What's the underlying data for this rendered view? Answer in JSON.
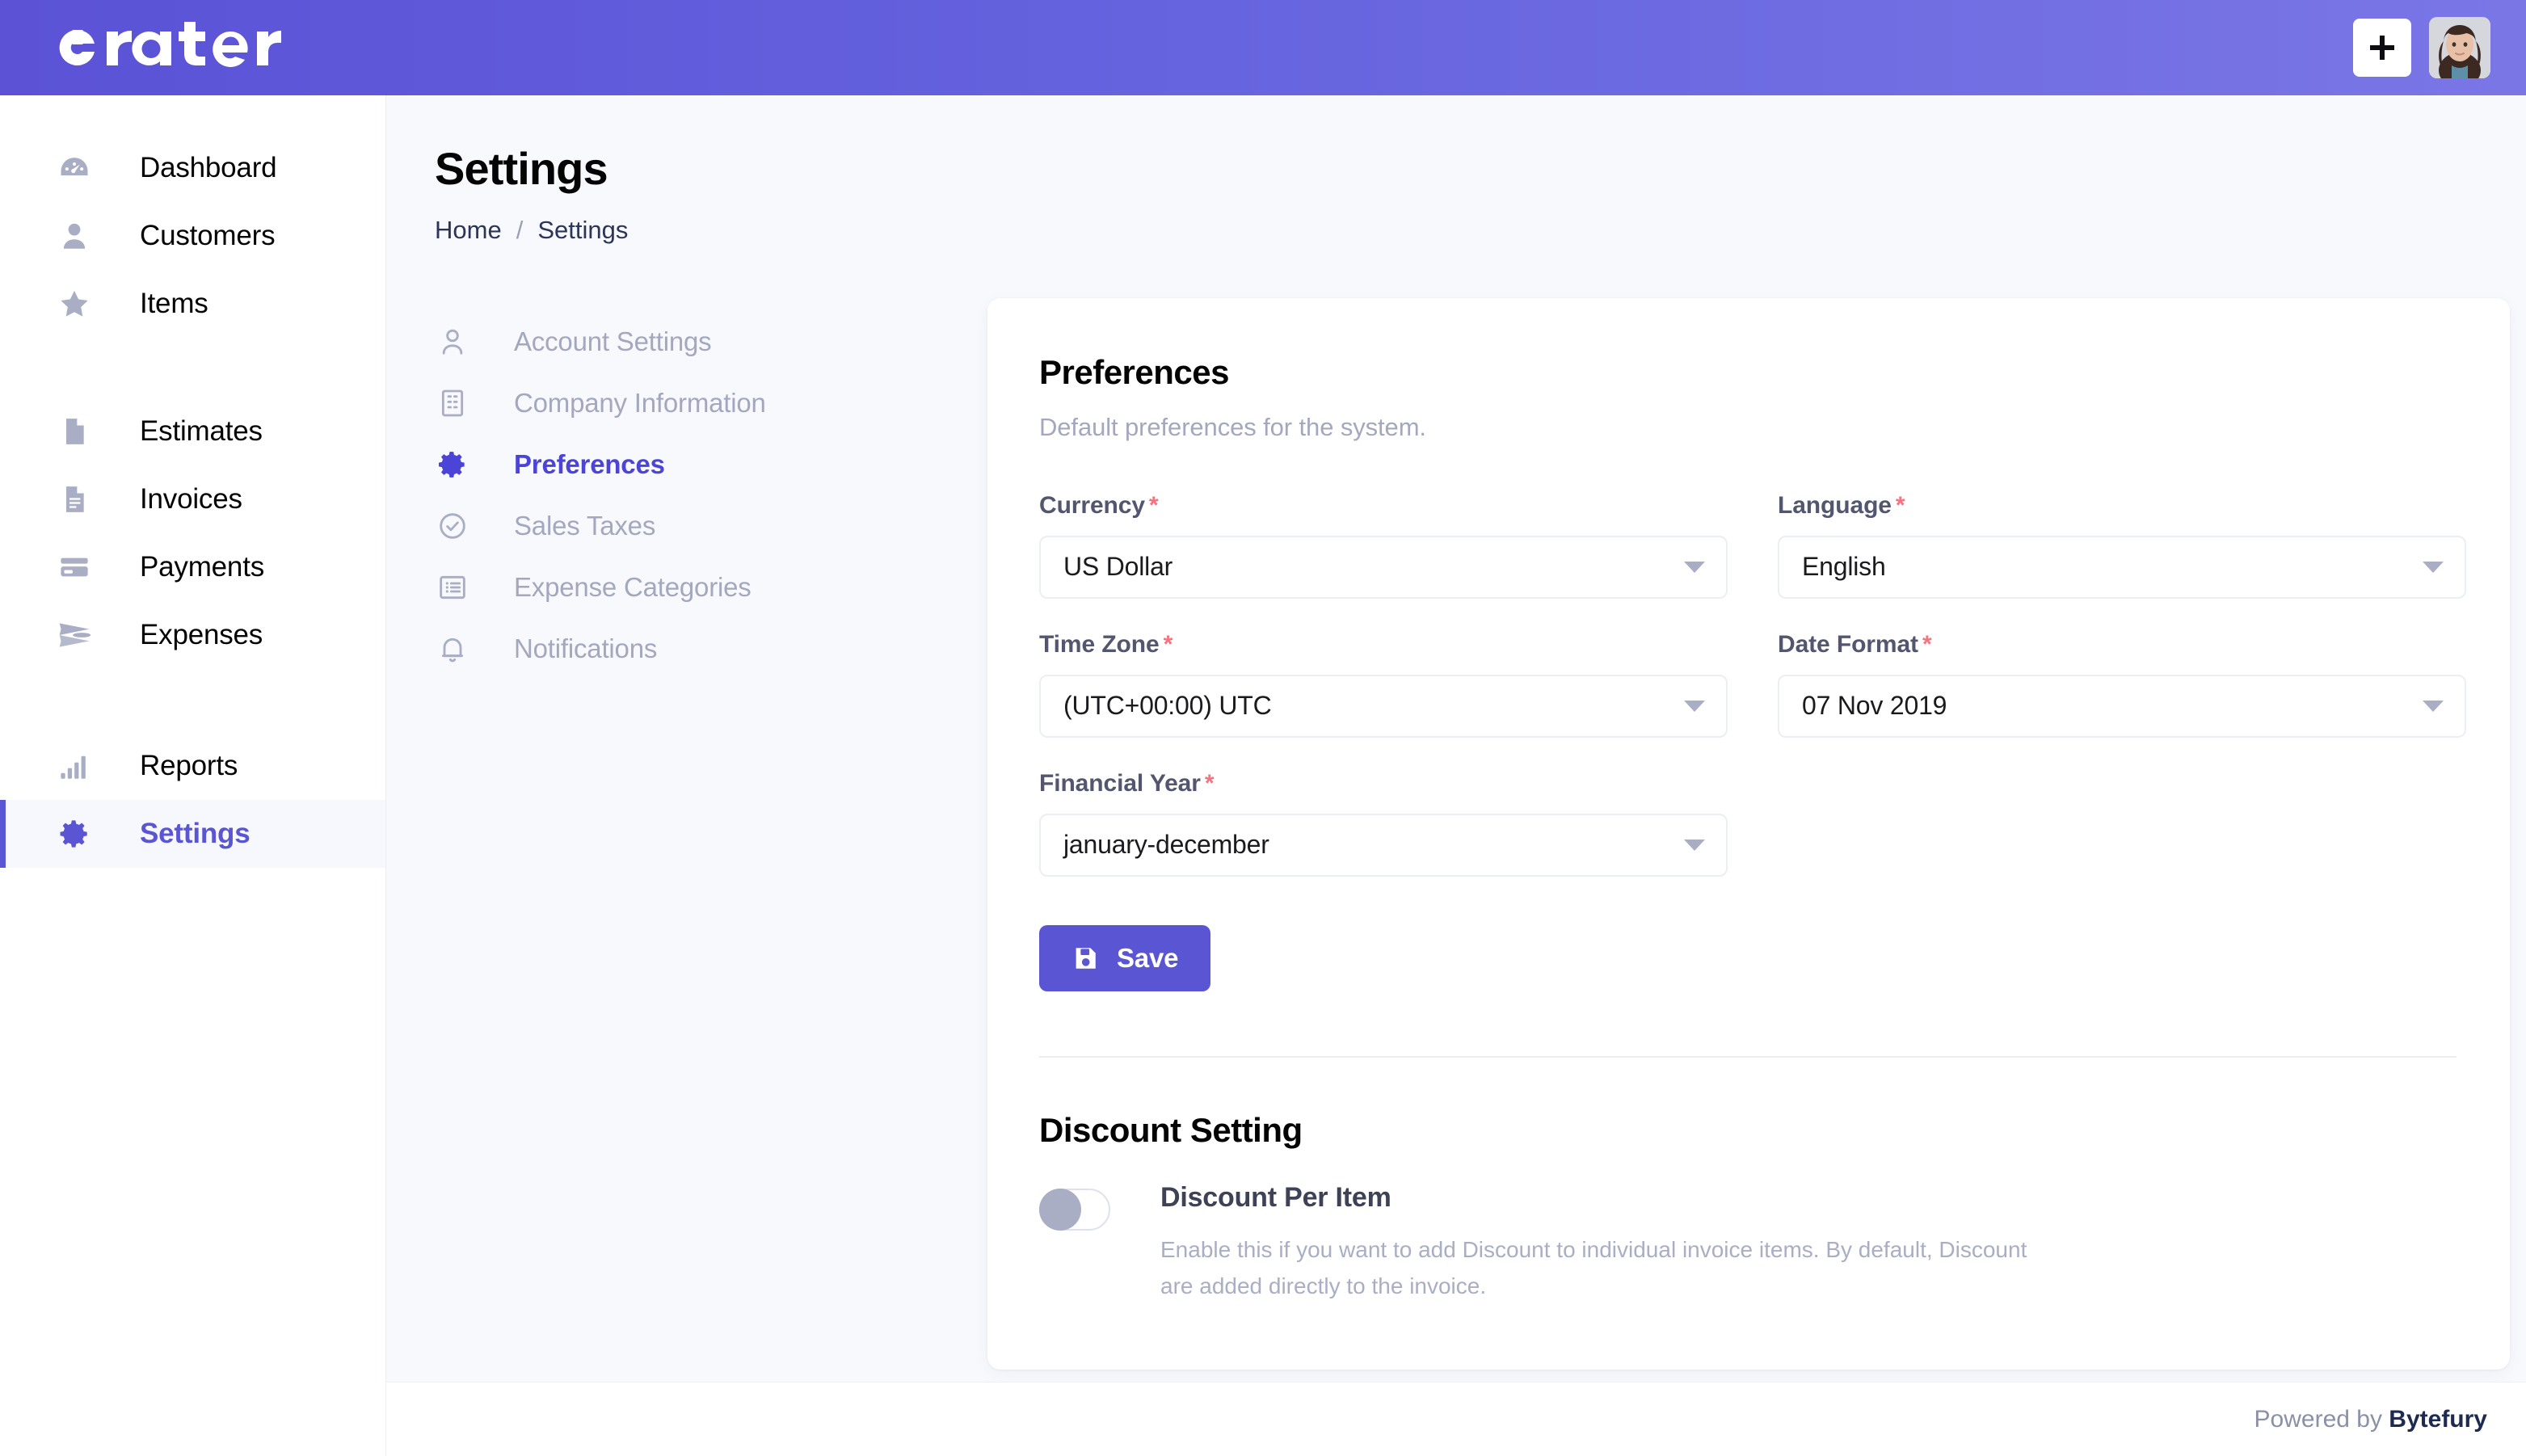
{
  "app": {
    "logo_text": "crater",
    "header_bg": "#6563DE",
    "accent": "#5A55D2"
  },
  "topbar": {
    "add_button_label": "+",
    "avatar_label": "User avatar"
  },
  "sidebar": {
    "items": [
      {
        "label": "Dashboard",
        "icon": "dashboard-icon",
        "active": false
      },
      {
        "label": "Customers",
        "icon": "user-icon",
        "active": false
      },
      {
        "label": "Items",
        "icon": "star-icon",
        "active": false
      },
      {
        "label": "Estimates",
        "icon": "document-icon",
        "active": false
      },
      {
        "label": "Invoices",
        "icon": "invoice-icon",
        "active": false
      },
      {
        "label": "Payments",
        "icon": "credit-card-icon",
        "active": false
      },
      {
        "label": "Expenses",
        "icon": "paper-plane-icon",
        "active": false
      },
      {
        "label": "Reports",
        "icon": "bar-chart-icon",
        "active": false
      },
      {
        "label": "Settings",
        "icon": "gear-icon",
        "active": true
      }
    ]
  },
  "page": {
    "title": "Settings",
    "breadcrumb": {
      "home": "Home",
      "separator": "/",
      "current": "Settings"
    }
  },
  "settings_menu": {
    "items": [
      {
        "label": "Account Settings",
        "icon": "person-outline-icon",
        "active": false
      },
      {
        "label": "Company Information",
        "icon": "building-icon",
        "active": false
      },
      {
        "label": "Preferences",
        "icon": "gear-icon",
        "active": true
      },
      {
        "label": "Sales Taxes",
        "icon": "check-circle-icon",
        "active": false
      },
      {
        "label": "Expense Categories",
        "icon": "list-icon",
        "active": false
      },
      {
        "label": "Notifications",
        "icon": "bell-icon",
        "active": false
      }
    ]
  },
  "preferences": {
    "title": "Preferences",
    "subtitle": "Default preferences for the system.",
    "required_mark": "*",
    "fields": {
      "currency": {
        "label": "Currency",
        "value": "US Dollar",
        "required": true
      },
      "language": {
        "label": "Language",
        "value": "English",
        "required": true
      },
      "time_zone": {
        "label": "Time Zone",
        "value": "(UTC+00:00) UTC",
        "required": true
      },
      "date_format": {
        "label": "Date Format",
        "value": "07 Nov 2019",
        "required": true
      },
      "financial_year": {
        "label": "Financial Year",
        "value": "january-december",
        "required": true
      }
    },
    "save_label": "Save"
  },
  "discount_setting": {
    "title": "Discount Setting",
    "toggle_label": "Discount Per Item",
    "toggle_on": false,
    "description": "Enable this if you want to add Discount to individual invoice items. By default, Discount are added directly to the invoice."
  },
  "footer": {
    "prefix": "Powered by ",
    "brand": "Bytefury"
  }
}
